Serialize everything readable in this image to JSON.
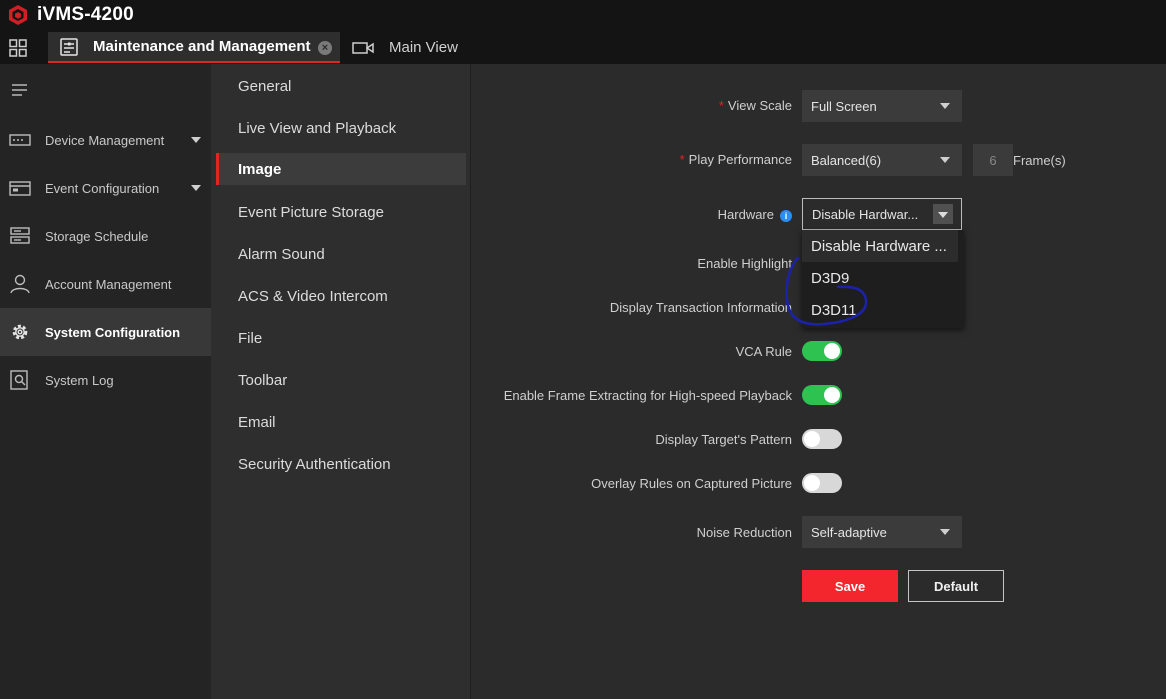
{
  "app": {
    "title": "iVMS-4200"
  },
  "tabs": [
    {
      "label": "Maintenance and Management",
      "active": true
    },
    {
      "label": "Main View",
      "active": false
    }
  ],
  "leftnav": {
    "items": [
      {
        "label": "Device Management",
        "icon": "device-icon",
        "expandable": true
      },
      {
        "label": "Event Configuration",
        "icon": "event-icon",
        "expandable": true
      },
      {
        "label": "Storage Schedule",
        "icon": "storage-icon",
        "expandable": false
      },
      {
        "label": "Account Management",
        "icon": "account-icon",
        "expandable": false
      },
      {
        "label": "System Configuration",
        "icon": "gear-icon",
        "expandable": false,
        "active": true
      },
      {
        "label": "System Log",
        "icon": "log-icon",
        "expandable": false
      }
    ]
  },
  "subnav": {
    "items": [
      {
        "label": "General"
      },
      {
        "label": "Live View and Playback"
      },
      {
        "label": "Image",
        "active": true
      },
      {
        "label": "Event Picture Storage"
      },
      {
        "label": "Alarm Sound"
      },
      {
        "label": "ACS & Video Intercom"
      },
      {
        "label": "File"
      },
      {
        "label": "Toolbar"
      },
      {
        "label": "Email"
      },
      {
        "label": "Security Authentication"
      }
    ]
  },
  "form": {
    "required_mark": "*",
    "view_scale": {
      "label": "View Scale",
      "value": "Full Screen"
    },
    "play_performance": {
      "label": "Play Performance",
      "value": "Balanced(6)",
      "frames": "6",
      "unit": "Frame(s)"
    },
    "hardware": {
      "label": "Hardware",
      "info": "i",
      "value": "Disable Hardwar...",
      "options": [
        "Disable Hardware ...",
        "D3D9",
        "D3D11"
      ]
    },
    "enable_highlight": {
      "label": "Enable Highlight"
    },
    "display_transaction": {
      "label": "Display Transaction Information"
    },
    "vca_rule": {
      "label": "VCA Rule",
      "on": true
    },
    "frame_extracting": {
      "label": "Enable Frame Extracting for High-speed Playback",
      "on": true
    },
    "target_pattern": {
      "label": "Display Target's Pattern",
      "on": false
    },
    "overlay_rules": {
      "label": "Overlay Rules on Captured Picture",
      "on": false
    },
    "noise_reduction": {
      "label": "Noise Reduction",
      "value": "Self-adaptive"
    },
    "save_label": "Save",
    "default_label": "Default"
  },
  "colors": {
    "accent_red": "#e02525",
    "toggle_on": "#2ec250",
    "save_button": "#f2262c",
    "info_blue": "#2d8cf0",
    "annotation_ink": "#1c22a8"
  }
}
